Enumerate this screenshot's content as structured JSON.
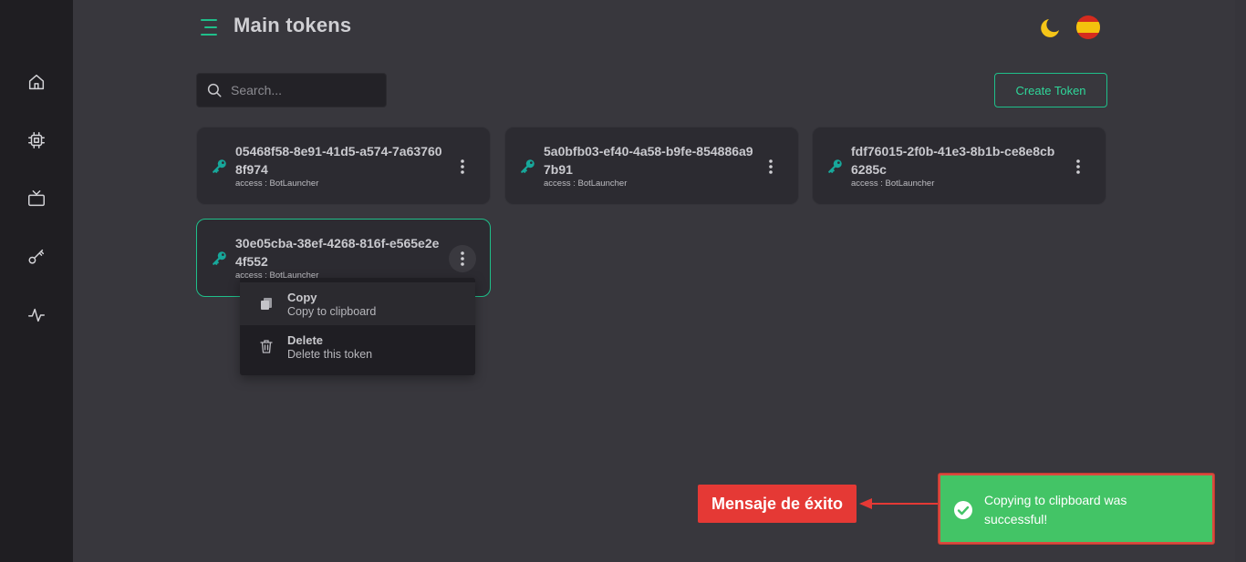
{
  "header": {
    "title": "Main tokens"
  },
  "search": {
    "placeholder": "Search..."
  },
  "toolbar": {
    "create_label": "Create Token"
  },
  "colors": {
    "accent": "#1fbf8a",
    "sidebar_bg": "#1f1e22",
    "page_bg": "#38373d",
    "card_bg": "#2c2b31",
    "toast_success": "#43c466",
    "annotation_red": "#e53935"
  },
  "sidebar": {
    "items": [
      {
        "icon": "home-icon"
      },
      {
        "icon": "chip-icon"
      },
      {
        "icon": "tv-icon"
      },
      {
        "icon": "key-icon"
      },
      {
        "icon": "activity-icon"
      }
    ]
  },
  "tokens": [
    {
      "id": "05468f58-8e91-41d5-a574-7a637608f974",
      "access": "access : BotLauncher"
    },
    {
      "id": "5a0bfb03-ef40-4a58-b9fe-854886a97b91",
      "access": "access : BotLauncher"
    },
    {
      "id": "fdf76015-2f0b-41e3-8b1b-ce8e8cb6285c",
      "access": "access : BotLauncher"
    },
    {
      "id": "30e05cba-38ef-4268-816f-e565e2e4f552",
      "access": "access : BotLauncher"
    }
  ],
  "context_menu": {
    "items": [
      {
        "title": "Copy",
        "description": "Copy to clipboard",
        "icon": "copy-icon"
      },
      {
        "title": "Delete",
        "description": "Delete this token",
        "icon": "trash-icon"
      }
    ]
  },
  "annotation": {
    "label": "Mensaje de éxito"
  },
  "toast": {
    "message": "Copying to clipboard was successful!"
  }
}
